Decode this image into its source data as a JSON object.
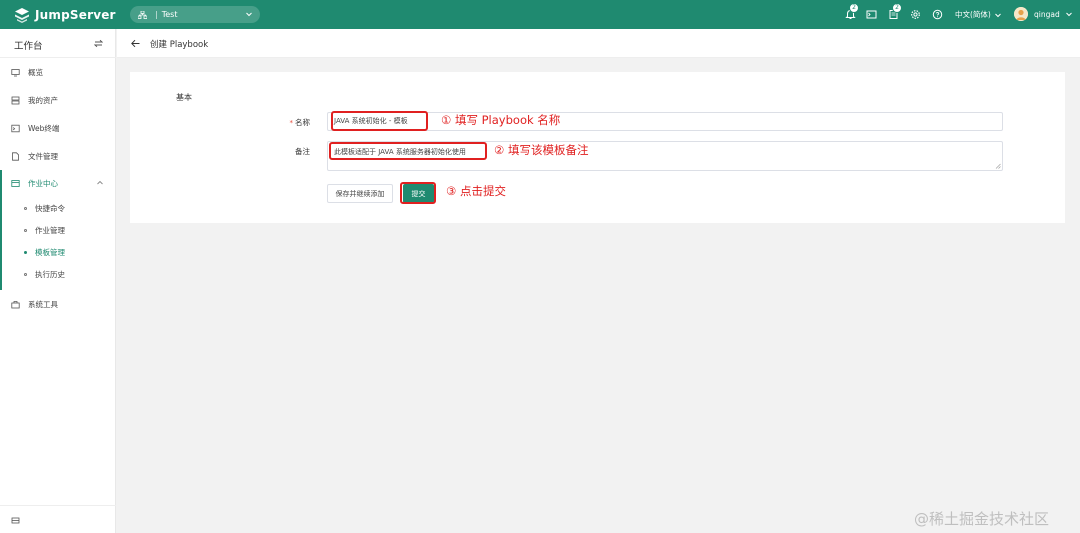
{
  "header": {
    "brand": "JumpServer",
    "org": {
      "name": "Test",
      "separator": "|"
    },
    "notification_count": "2",
    "ticket_count": "2",
    "language": "中文(简体)",
    "username": "qingad",
    "brand_color": "#1f8a70"
  },
  "sidebar": {
    "title": "工作台",
    "items": [
      {
        "label": "概览",
        "icon": "overview-icon"
      },
      {
        "label": "我的资产",
        "icon": "assets-icon"
      },
      {
        "label": "Web终端",
        "icon": "terminal-icon"
      },
      {
        "label": "文件管理",
        "icon": "file-icon"
      },
      {
        "label": "作业中心",
        "icon": "job-center-icon"
      },
      {
        "label": "系统工具",
        "icon": "tools-icon"
      }
    ],
    "sub_items": [
      {
        "label": "快捷命令"
      },
      {
        "label": "作业管理"
      },
      {
        "label": "模板管理"
      },
      {
        "label": "执行历史"
      }
    ]
  },
  "page": {
    "title": "创建 Playbook"
  },
  "form": {
    "section": "基本",
    "name_required_mark": "*",
    "name_label": "名称",
    "name_value": "JAVA 系统初始化 - 模板",
    "comment_label": "备注",
    "comment_value": "此模板适配于 JAVA 系统服务器初始化使用",
    "save_continue_label": "保存并继续添加",
    "submit_label": "提交"
  },
  "annotations": {
    "step1": "① 填写 Playbook 名称",
    "step2": "② 填写该模板备注",
    "step3": "③ 点击提交",
    "color": "#e02020"
  },
  "watermark": "@稀土掘金技术社区"
}
